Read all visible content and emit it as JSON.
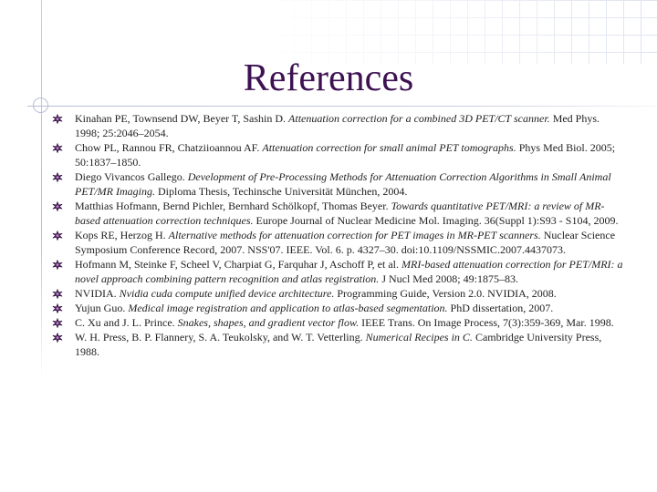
{
  "slide": {
    "title": "References"
  },
  "references": [
    {
      "before": "Kinahan PE, Townsend DW, Beyer T, Sashin D. ",
      "italic": "Attenuation correction for a combined 3D PET/CT scanner.",
      "after": " Med Phys. 1998; 25:2046–2054."
    },
    {
      "before": "Chow PL, Rannou FR, Chatziioannou AF. ",
      "italic": "Attenuation correction for small animal PET tomographs.",
      "after": " Phys Med Biol. 2005; 50:1837–1850."
    },
    {
      "before": "Diego Vivancos Gallego. ",
      "italic": "Development of Pre-Processing Methods for Attenuation Correction Algorithms in Small Animal PET/MR Imaging.",
      "after": " Diploma Thesis, Techinsche Universität München, 2004."
    },
    {
      "before": "Matthias Hofmann, Bernd Pichler, Bernhard Schölkopf, Thomas Beyer. ",
      "italic": "Towards quantitative PET/MRI: a review of MR-based attenuation correction techniques.",
      "after": " Europe Journal of Nuclear Medicine Mol. Imaging. 36(Suppl 1):S93 - S104, 2009."
    },
    {
      "before": "Kops RE, Herzog H. ",
      "italic": "Alternative methods for attenuation correction for PET images in MR-PET scanners.",
      "after": " Nuclear Science Symposium Conference Record, 2007. NSS'07. IEEE. Vol. 6. p. 4327–30. doi:10.1109/NSSMIC.2007.4437073."
    },
    {
      "before": " Hofmann M, Steinke F, Scheel V, Charpiat G, Farquhar J, Aschoff P, et al. ",
      "italic": "MRI-based attenuation correction for PET/MRI: a novel approach combining pattern recognition and atlas registration.",
      "after": " J Nucl Med 2008; 49:1875–83."
    },
    {
      "before": "NVIDIA. ",
      "italic": "Nvidia cuda compute unified device architecture.",
      "after": "  Programming Guide, Version 2.0. NVIDIA, 2008."
    },
    {
      "before": "Yujun Guo. ",
      "italic": "Medical image registration and application to atlas-based segmentation.",
      "after": " PhD dissertation, 2007."
    },
    {
      "before": "C. Xu and J. L. Prince. ",
      "italic": "Snakes, shapes, and gradient vector flow.",
      "after": "  IEEE Trans. On Image Process, 7(3):359-369, Mar. 1998."
    },
    {
      "before": "W. H. Press, B. P. Flannery, S. A. Teukolsky, and W. T. Vetterling. ",
      "italic": "Numerical Recipes in C.",
      "after": " Cambridge University Press, 1988."
    }
  ],
  "colors": {
    "title": "#3d1152",
    "text": "#1e1e1e",
    "bullet_fill": "#5a1f6e",
    "bullet_outline": "#2a0f36",
    "rule_lines": "#b8bdd4"
  },
  "icons": {
    "bullet": "winged-bullet-icon"
  }
}
